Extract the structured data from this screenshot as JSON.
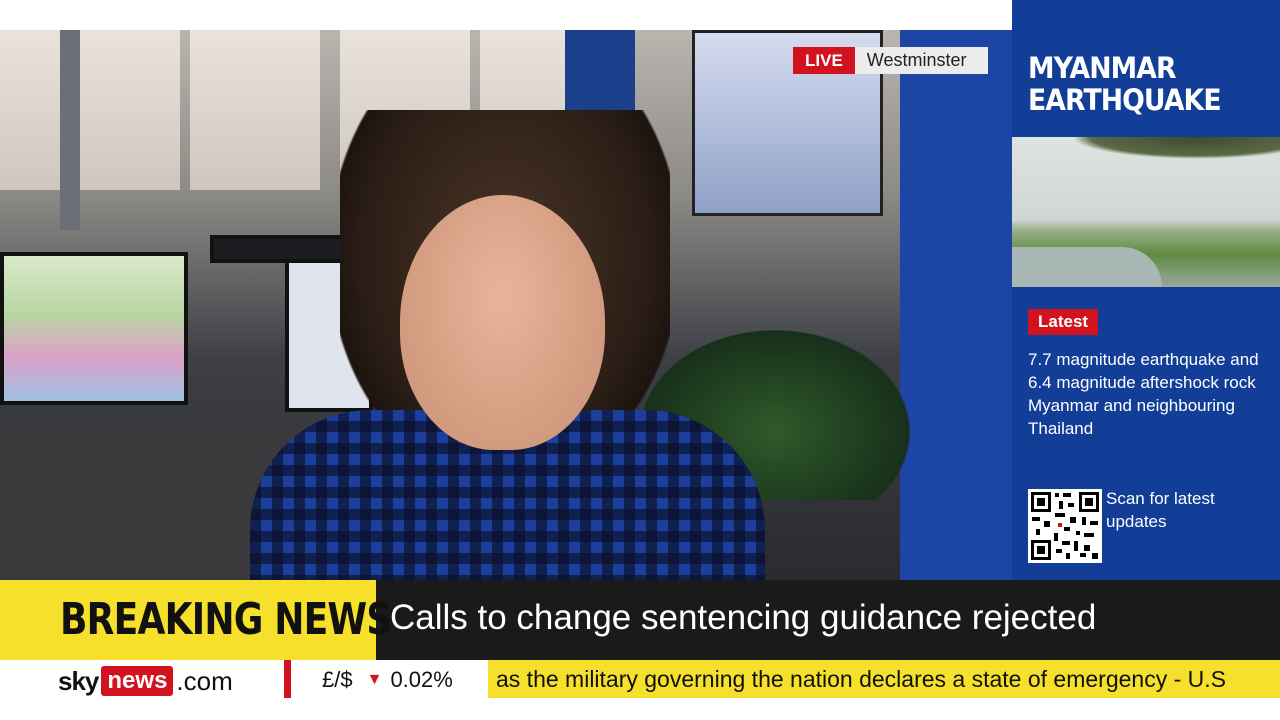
{
  "live_bug": {
    "live_label": "LIVE",
    "location": "Westminster"
  },
  "side_panel": {
    "title_line1": "MYANMAR",
    "title_line2": "EARTHQUAKE",
    "latest_label": "Latest",
    "story": "7.7 magnitude earthquake and 6.4 magnitude aftershock rock Myanmar and neighbouring Thailand",
    "qr_caption": "Scan for latest updates"
  },
  "ticker": {
    "breaking_label": "BREAKING NEWS",
    "headline": "Calls to change sentencing guidance rejected"
  },
  "bottom_strip": {
    "logo_sky": "sky",
    "logo_news": "news",
    "logo_com": ".com",
    "fx_pair": "£/$",
    "fx_arrow": "▼",
    "fx_change": "0.02%",
    "crawl_text": "as the military governing the nation declares a state of emergency - U.S"
  },
  "colors": {
    "brand_red": "#d3121f",
    "panel_blue": "#123e98",
    "breaking_yellow": "#f6e02b",
    "ticker_dark": "#1a1a1a"
  }
}
